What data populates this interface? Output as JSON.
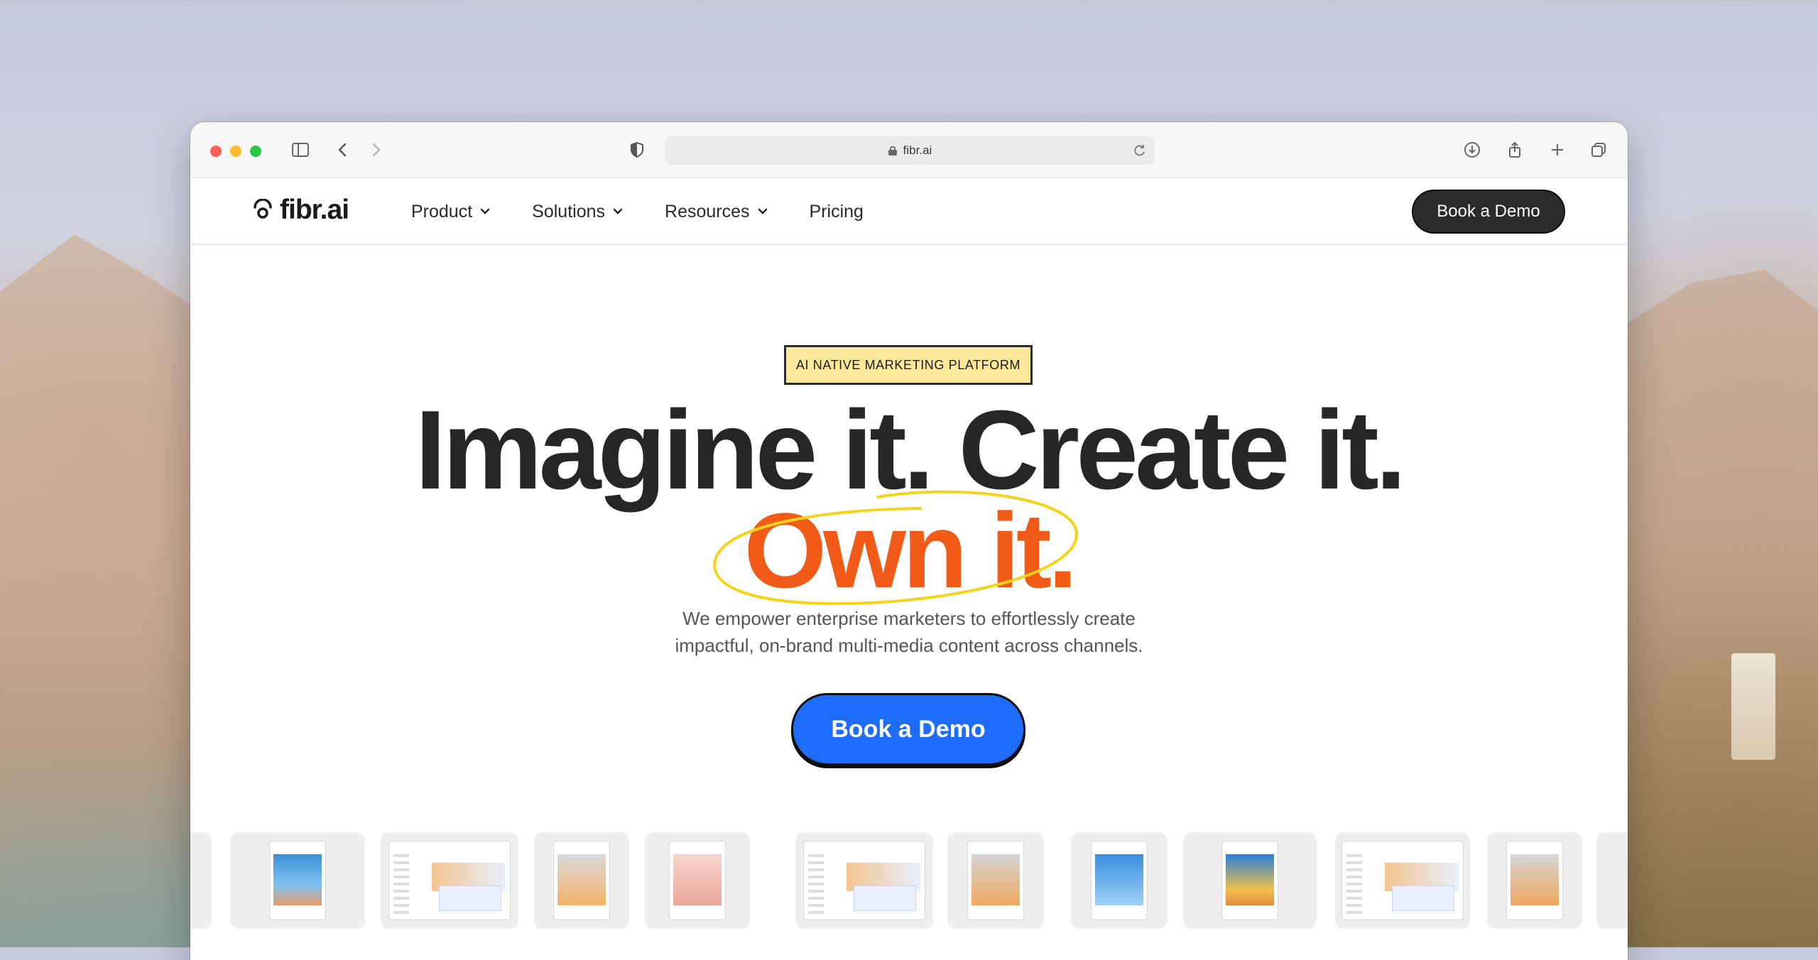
{
  "browser": {
    "url": "fibr.ai"
  },
  "nav": {
    "logo": "fibr.ai",
    "items": [
      {
        "label": "Product",
        "has_dropdown": true
      },
      {
        "label": "Solutions",
        "has_dropdown": true
      },
      {
        "label": "Resources",
        "has_dropdown": true
      },
      {
        "label": "Pricing",
        "has_dropdown": false
      }
    ],
    "cta_label": "Book a Demo"
  },
  "hero": {
    "badge": "AI NATIVE MARKETING PLATFORM",
    "headline_line1": "Imagine it. Create it.",
    "headline_line2": "Own it.",
    "subtext_line1": "We empower enterprise marketers to effortlessly create",
    "subtext_line2": "impactful, on-brand multi-media content across channels.",
    "cta_label": "Book a Demo"
  },
  "colors": {
    "accent_orange": "#f25a18",
    "cta_blue": "#1f6cfb",
    "badge_yellow": "#fbe89a",
    "scribble_yellow": "#f6d31b"
  },
  "thumbnails": [
    "social",
    "email",
    "social",
    "social",
    "email",
    "social",
    "social",
    "social",
    "email",
    "social"
  ]
}
